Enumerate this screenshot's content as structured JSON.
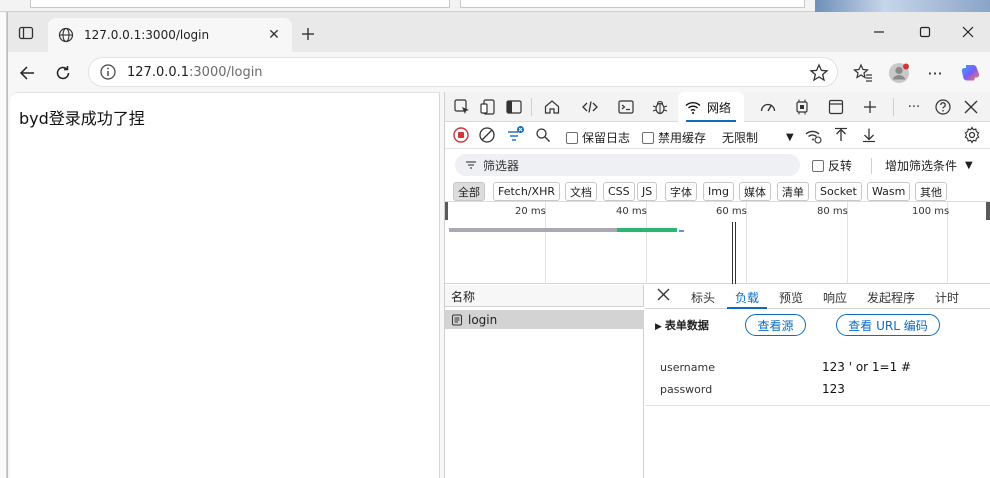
{
  "browser": {
    "tab_title": "127.0.0.1:3000/login",
    "url_host": "127.0.0.1",
    "url_rest": ":3000/login"
  },
  "page": {
    "message": "byd登录成功了捏"
  },
  "devtools": {
    "network_tab_label": "网络",
    "toolbar": {
      "preserve_log": "保留日志",
      "disable_cache": "禁用缓存",
      "throttle": "无限制"
    },
    "filter": {
      "placeholder": "筛选器",
      "invert": "反转",
      "more_filters": "增加筛选条件"
    },
    "type_filters": [
      "全部",
      "Fetch/XHR",
      "文档",
      "CSS",
      "JS",
      "字体",
      "Img",
      "媒体",
      "清单",
      "Socket",
      "Wasm",
      "其他"
    ],
    "timeline_ticks": [
      "20 ms",
      "40 ms",
      "60 ms",
      "80 ms",
      "100 ms"
    ],
    "requests": {
      "column_name": "名称",
      "items": [
        "login"
      ]
    },
    "detail_tabs": [
      "标头",
      "负载",
      "预览",
      "响应",
      "发起程序",
      "计时"
    ],
    "payload": {
      "section_title": "表单数据",
      "view_source": "查看源",
      "view_url_encoded": "查看 URL 编码",
      "fields": [
        {
          "key": "username",
          "value": "123 ' or 1=1 #"
        },
        {
          "key": "password",
          "value": "123"
        }
      ]
    }
  },
  "colors": {
    "accent": "#0f6cbd",
    "record_red": "#d13438",
    "timing_green": "#2bb673",
    "timing_gray": "#a9a9b3"
  }
}
